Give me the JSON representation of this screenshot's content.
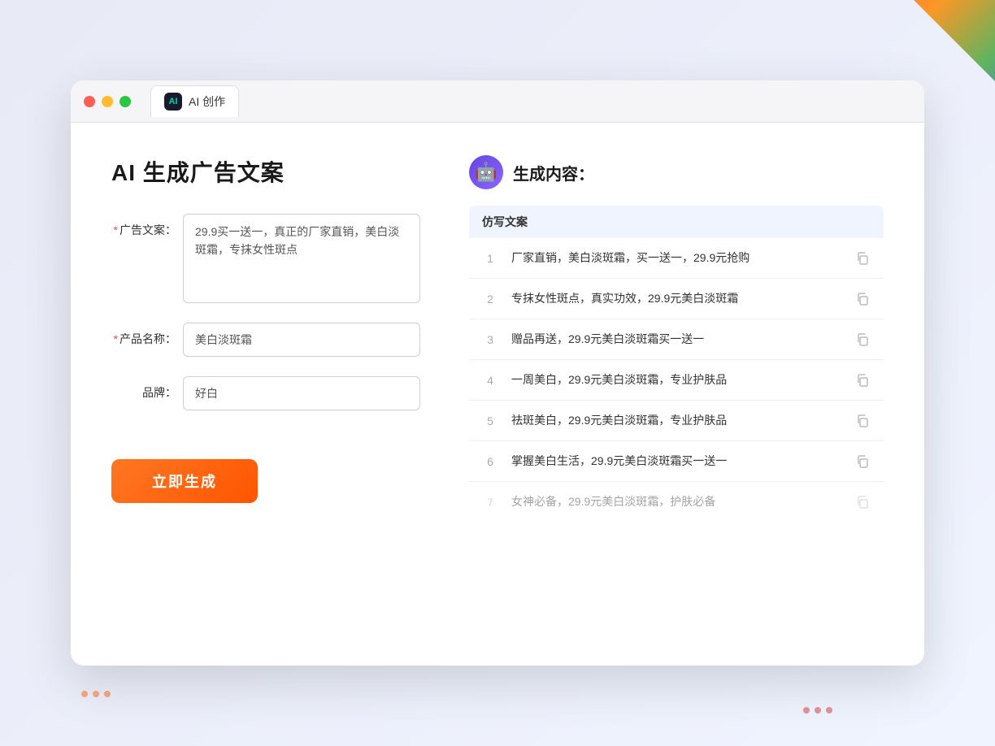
{
  "background": {
    "color": "#e8eaf6"
  },
  "window": {
    "titlebar": {
      "tab_icon_text": "AI",
      "tab_label": "AI 创作"
    },
    "left_panel": {
      "title": "AI 生成广告文案",
      "form": {
        "ad_copy_label": "广告文案：",
        "ad_copy_required": "*",
        "ad_copy_value": "29.9买一送一，真正的厂家直销，美白淡斑霜，专抹女性斑点",
        "product_label": "产品名称：",
        "product_required": "*",
        "product_value": "美白淡斑霜",
        "brand_label": "品牌：",
        "brand_value": "好白"
      },
      "generate_button": "立即生成"
    },
    "right_panel": {
      "title": "生成内容：",
      "table_header": "仿写文案",
      "results": [
        {
          "num": "1",
          "text": "厂家直销，美白淡斑霜，买一送一，29.9元抢购",
          "dimmed": false
        },
        {
          "num": "2",
          "text": "专抹女性斑点，真实功效，29.9元美白淡斑霜",
          "dimmed": false
        },
        {
          "num": "3",
          "text": "赠品再送，29.9元美白淡斑霜买一送一",
          "dimmed": false
        },
        {
          "num": "4",
          "text": "一周美白，29.9元美白淡斑霜，专业护肤品",
          "dimmed": false
        },
        {
          "num": "5",
          "text": "祛斑美白，29.9元美白淡斑霜，专业护肤品",
          "dimmed": false
        },
        {
          "num": "6",
          "text": "掌握美白生活，29.9元美白淡斑霜买一送一",
          "dimmed": false
        },
        {
          "num": "7",
          "text": "女神必备，29.9元美白淡斑霜，护肤必备",
          "dimmed": true
        }
      ]
    }
  }
}
